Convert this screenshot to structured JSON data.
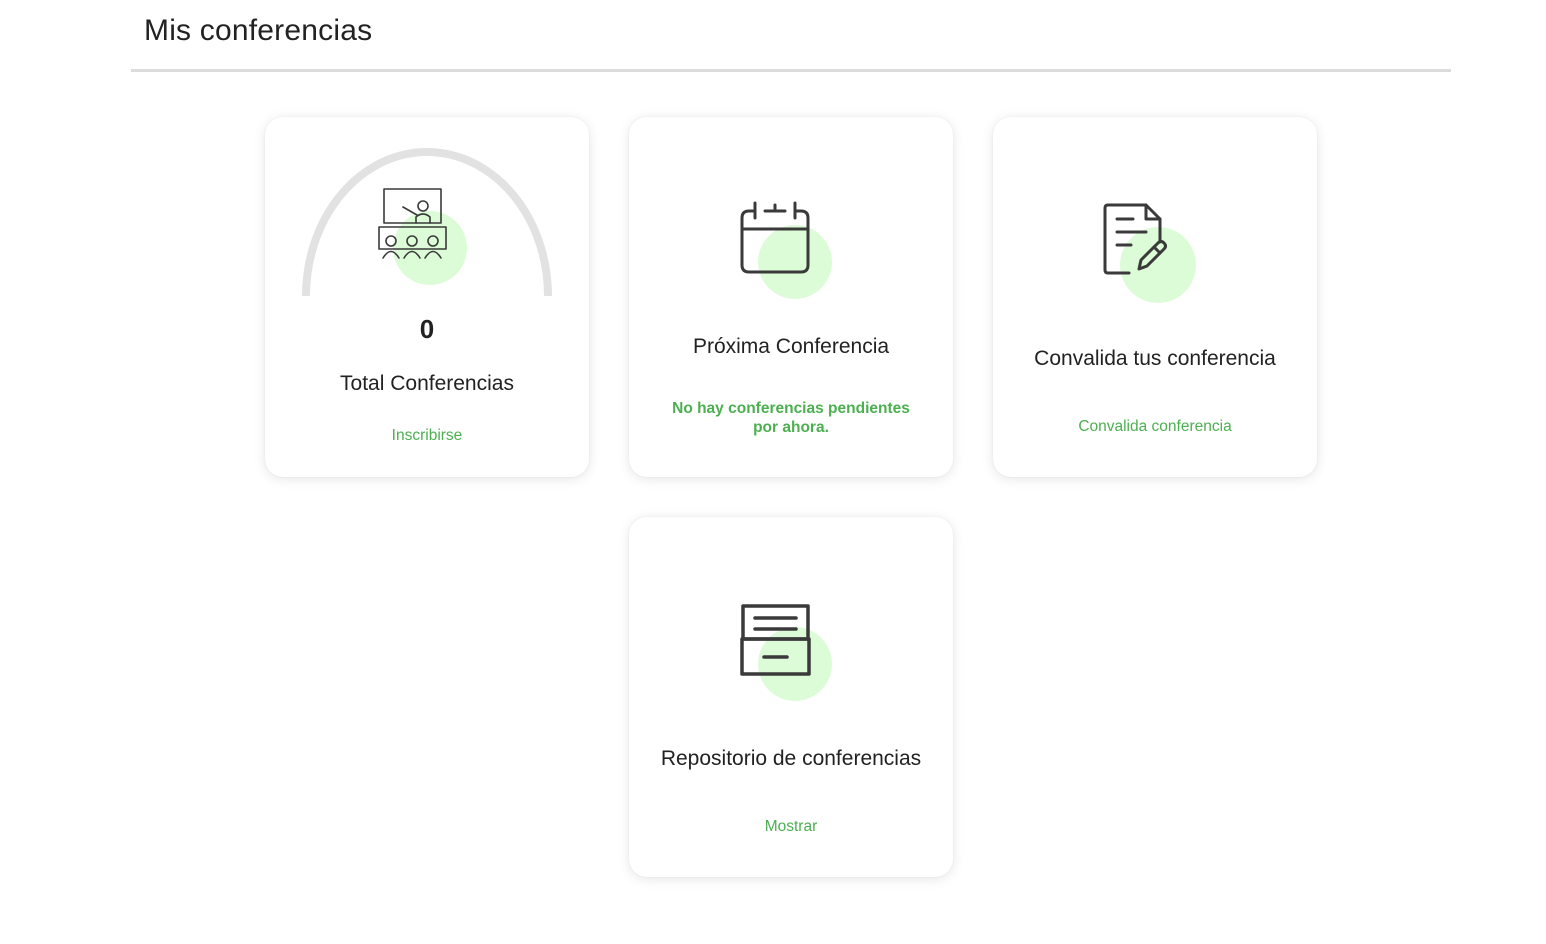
{
  "header": {
    "title": "Mis conferencias"
  },
  "colors": {
    "accent_green": "#4caf50",
    "icon_blob": "#dcfcd7",
    "gauge_track": "#e2e2e2",
    "text_dark": "#222222"
  },
  "cards": {
    "total": {
      "value": "0",
      "progress_fraction": 0,
      "title": "Total Conferencias",
      "link": "Inscribirse",
      "icon": "presentation-classroom-icon"
    },
    "next": {
      "title": "Próxima Conferencia",
      "note": "No hay conferencias pendientes por ahora.",
      "icon": "calendar-icon"
    },
    "validate": {
      "title": "Convalida tus conferencia",
      "link": "Convalida conferencia",
      "icon": "document-edit-icon"
    },
    "repository": {
      "title": "Repositorio de conferencias",
      "link": "Mostrar",
      "icon": "archive-drawer-icon"
    }
  }
}
